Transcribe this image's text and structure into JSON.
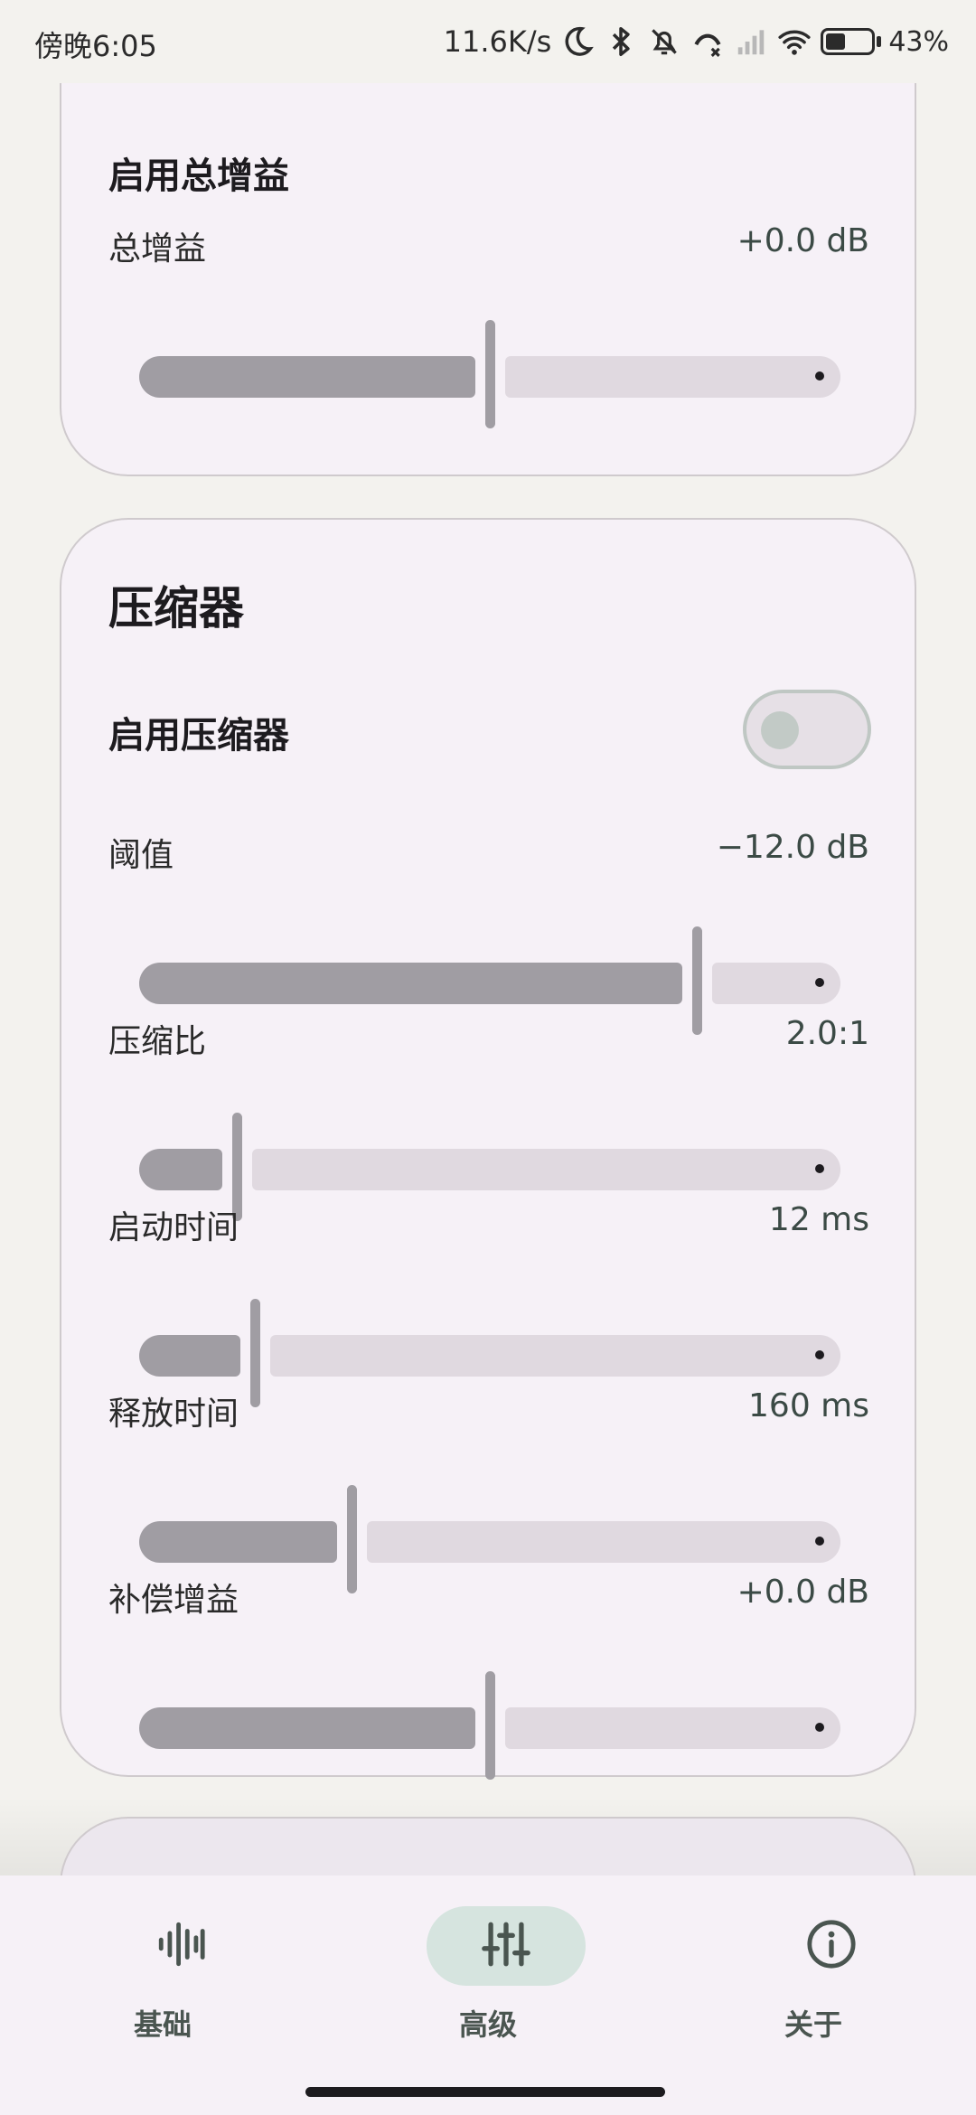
{
  "status_bar": {
    "time": "傍晚6:05",
    "network_speed": "11.6K/s",
    "battery_level": 0.43,
    "battery_pct": "43%",
    "icons": [
      "moon-icon",
      "bluetooth-icon",
      "bell-off-icon",
      "call-forward-icon",
      "signal-icon",
      "wifi-icon",
      "battery-icon"
    ]
  },
  "gain_card": {
    "enable_label": "启用总增益",
    "slider": {
      "label": "总增益",
      "value": "+0.0 dB",
      "fraction": 0.5
    }
  },
  "compressor_card": {
    "title": "压缩器",
    "enable_label": "启用压缩器",
    "enabled": false,
    "sliders": [
      {
        "label": "阈值",
        "value": "−12.0 dB",
        "fraction": 0.8
      },
      {
        "label": "压缩比",
        "value": "2.0:1",
        "fraction": 0.134
      },
      {
        "label": "启动时间",
        "value": "12 ms",
        "fraction": 0.161
      },
      {
        "label": "释放时间",
        "value": "160 ms",
        "fraction": 0.3
      },
      {
        "label": "补偿增益",
        "value": "+0.0 dB",
        "fraction": 0.5
      }
    ]
  },
  "nav": {
    "items": [
      {
        "label": "基础",
        "icon": "waveform-icon",
        "active": false
      },
      {
        "label": "高级",
        "icon": "sliders-icon",
        "active": true
      },
      {
        "label": "关于",
        "icon": "info-icon",
        "active": false
      }
    ]
  },
  "colors": {
    "accent_indicator": "#d6e4df",
    "slider_active": "#a09da3",
    "slider_inactive": "#e0d9e0",
    "card_bg": "#f6f1f7"
  }
}
